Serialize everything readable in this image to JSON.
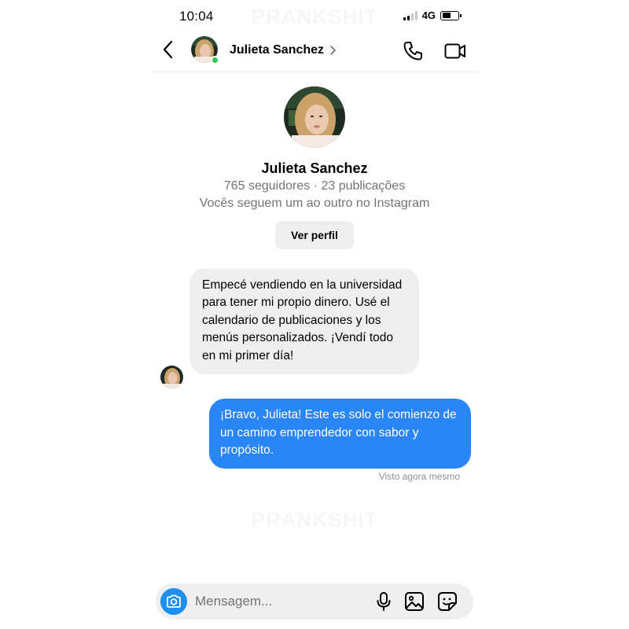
{
  "status_bar": {
    "time": "10:04",
    "network": "4G"
  },
  "watermark": "PRANKSHIT",
  "header": {
    "contact_name": "Julieta Sanchez"
  },
  "profile": {
    "name": "Julieta Sanchez",
    "stats": "765 seguidores · 23 publicações",
    "follow_status": "Vocês seguem um ao outro no Instagram",
    "view_profile_label": "Ver perfil"
  },
  "messages": [
    {
      "direction": "incoming",
      "text": "Empecé vendiendo en la universidad para tener mi propio dinero. Usé el calendario de publicaciones y los menús personalizados. ¡Vendí todo en mi primer día!"
    },
    {
      "direction": "outgoing",
      "text": "¡Bravo, Julieta! Este es solo el comienzo de un camino emprendedor con sabor y propósito."
    }
  ],
  "seen_status": "Visto agora mesmo",
  "composer": {
    "placeholder": "Mensagem..."
  },
  "icons": {
    "back": "chevron-left-icon",
    "call": "phone-icon",
    "video": "video-camera-icon",
    "camera": "camera-icon",
    "mic": "microphone-icon",
    "gallery": "image-icon",
    "sticker": "sticker-icon"
  },
  "colors": {
    "outgoing_bubble": "#2a85f7",
    "incoming_bubble": "#efefef",
    "online": "#2ec84a",
    "camera_button": "#1d8ff0"
  }
}
